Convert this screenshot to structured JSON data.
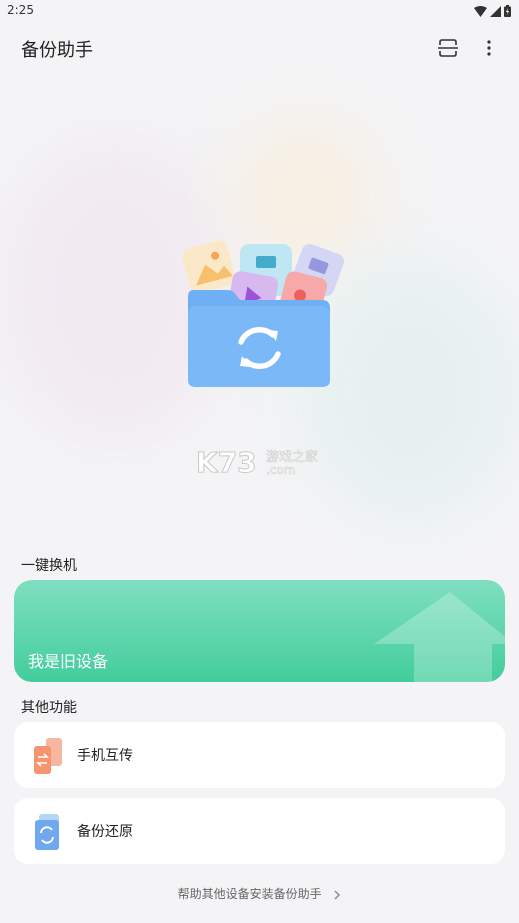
{
  "status_bar": {
    "time": "2:25"
  },
  "app_bar": {
    "title": "备份助手"
  },
  "one_click": {
    "section_title": "一键换机",
    "card_label": "我是旧设备"
  },
  "other": {
    "section_title": "其他功能",
    "items": [
      {
        "label": "手机互传",
        "icon": "phone-transfer-icon"
      },
      {
        "label": "备份还原",
        "icon": "backup-restore-icon"
      }
    ]
  },
  "footer": {
    "link": "帮助其他设备安装备份助手"
  },
  "watermark": {
    "brand": "K73",
    "site": "游戏之家",
    "domain": ".com"
  },
  "colors": {
    "accent_green": "#43cd9c",
    "folder_blue": "#6fb0f5",
    "transfer_orange": "#f4956f",
    "background": "#f4f4f6"
  }
}
